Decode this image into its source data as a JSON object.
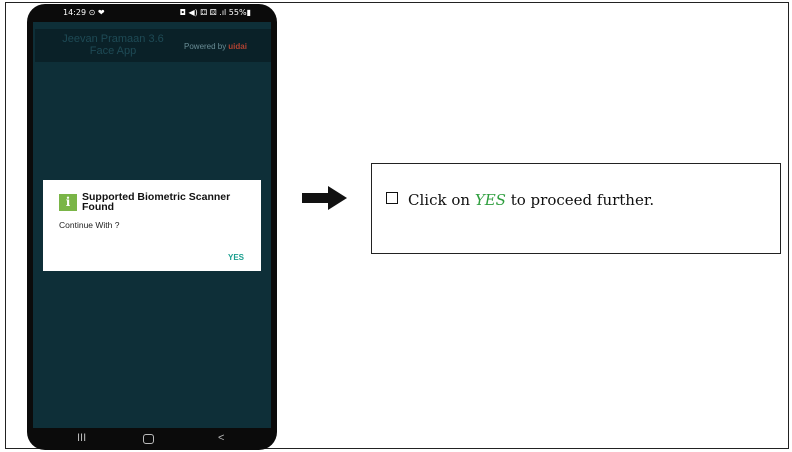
{
  "phone": {
    "status": {
      "time": "14:29 ⊙ ❤",
      "indicators": "◘ ◀) ⚃ ⚄ .ıl 55%▮"
    },
    "app": {
      "title_line1": "Jeevan Pramaan 3.6",
      "title_line2": "Face App",
      "powered_by": "Powered by",
      "brand": "uidai"
    },
    "dialog": {
      "icon": "info-icon",
      "icon_glyph": "i",
      "title": "Supported Biometric Scanner Found",
      "message": "Continue With ?",
      "yes_label": "YES"
    },
    "nav": {
      "recents_glyph": "III",
      "back_glyph": "<"
    }
  },
  "callout": {
    "prefix": "Click on",
    "highlight": "YES",
    "suffix": "to proceed further."
  },
  "colors": {
    "screen_bg": "#0e2f38",
    "yes_button": "#1a9e8e",
    "yes_highlight": "#2e9e3e",
    "info_icon": "#7ab547"
  }
}
